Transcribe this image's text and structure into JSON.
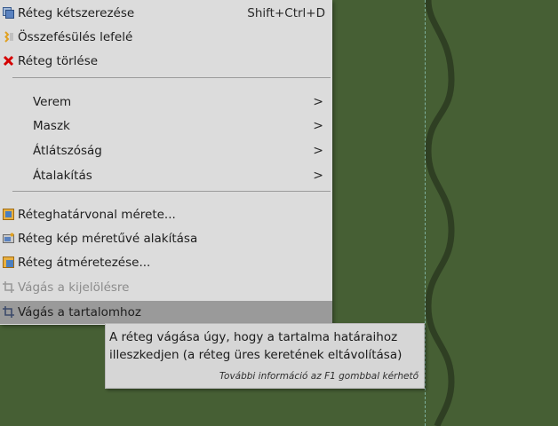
{
  "menu": {
    "items": [
      {
        "label": "Réteg kétszerezése",
        "accel": "Shift+Ctrl+D",
        "icon": "duplicate-layer-icon"
      },
      {
        "label": "Összefésülés lefelé",
        "icon": "merge-down-icon"
      },
      {
        "label": "Réteg törlése",
        "icon": "delete-icon"
      },
      {
        "label": "Verem",
        "submenu": true
      },
      {
        "label": "Maszk",
        "submenu": true
      },
      {
        "label": "Átlátszóság",
        "submenu": true
      },
      {
        "label": "Átalakítás",
        "submenu": true
      },
      {
        "label": "Réteghatárvonal mérete...",
        "icon": "layer-boundary-size-icon"
      },
      {
        "label": "Réteg kép méretűvé alakítása",
        "icon": "layer-to-image-size-icon"
      },
      {
        "label": "Réteg átméretezése...",
        "icon": "scale-layer-icon"
      },
      {
        "label": "Vágás a kijelölésre",
        "icon": "crop-icon",
        "disabled": true
      },
      {
        "label": "Vágás a tartalomhoz",
        "icon": "crop-icon",
        "hover": true
      }
    ],
    "submenu_arrow": ">"
  },
  "tooltip": {
    "line1": "A réteg vágása úgy, hogy a tartalma határaihoz",
    "line2": "illeszkedjen (a réteg üres keretének eltávolítása)",
    "help": "További információ az F1 gombbal kérhető"
  },
  "colors": {
    "canvas": "#465f34",
    "menu_bg": "#dcdcdc",
    "hover_bg": "#9a9a9a",
    "delete_icon": "#d40000"
  }
}
